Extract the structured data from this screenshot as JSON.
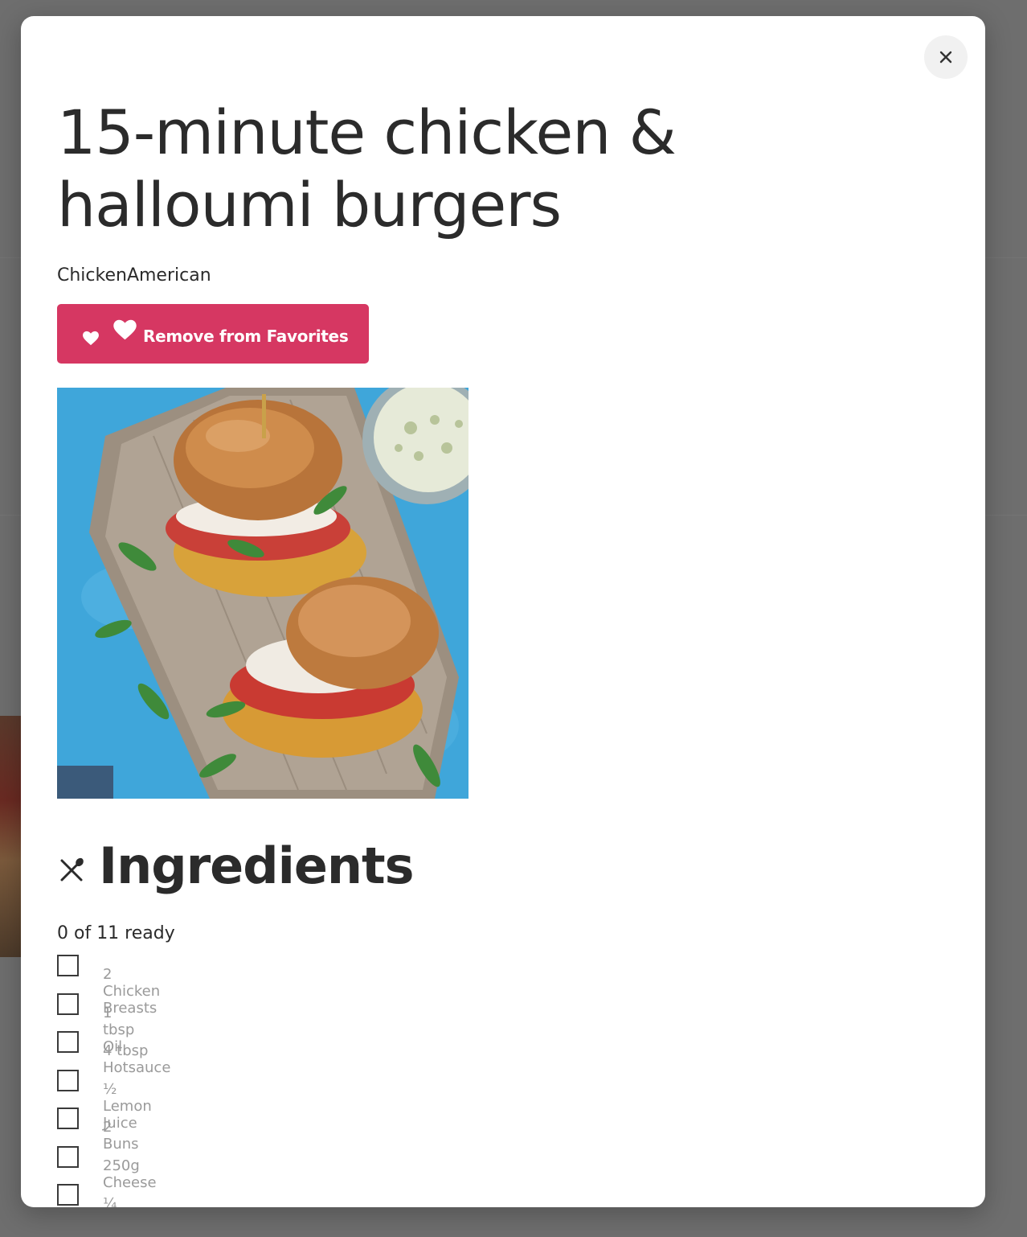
{
  "modal": {
    "close_icon": "close-icon",
    "title": "15-minute chicken & halloumi burgers",
    "tags": "ChickenAmerican",
    "favorite_button": {
      "label": "Remove from Favorites",
      "icons": [
        "heart-icon",
        "heart-icon"
      ],
      "color": "#d63762"
    },
    "image": {
      "alt": "15-minute chicken & halloumi burgers"
    },
    "ingredients": {
      "icon": "utensils-icon",
      "heading": "Ingredients",
      "progress_text": "0 of 11 ready",
      "items": [
        {
          "text": "2 Chicken Breasts",
          "checked": false
        },
        {
          "text": "1 tbsp Oil",
          "checked": false
        },
        {
          "text": "4 tbsp Hotsauce",
          "checked": false
        },
        {
          "text": "½ Lemon Juice",
          "checked": false
        },
        {
          "text": "2 Buns",
          "checked": false
        },
        {
          "text": "250g Cheese",
          "checked": false
        },
        {
          "text": "¼ Cabbage",
          "checked": false
        }
      ]
    }
  }
}
